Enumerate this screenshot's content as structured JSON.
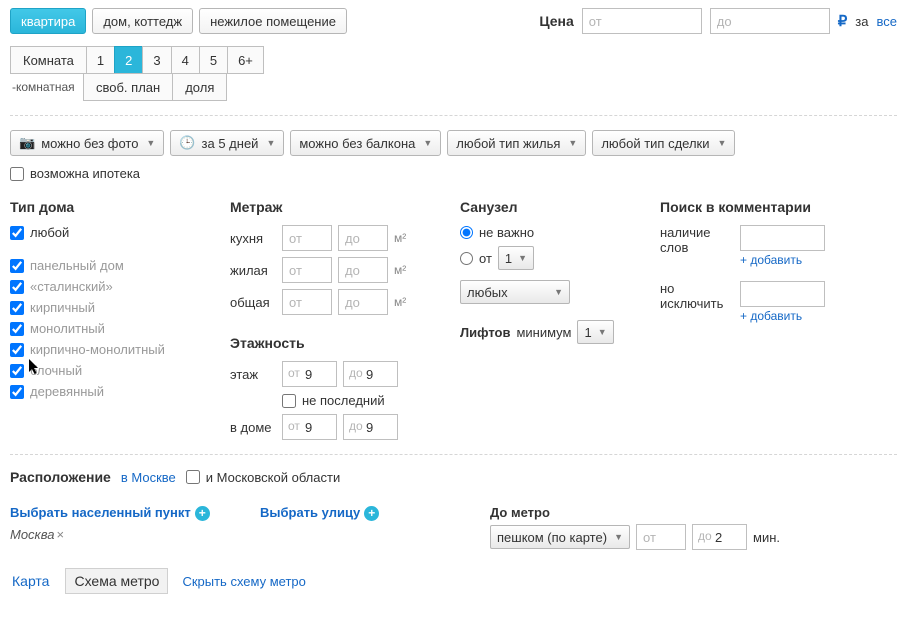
{
  "tabs": {
    "apartment": "квартира",
    "house": "дом, коттедж",
    "nonres": "нежилое помещение"
  },
  "price": {
    "label": "Цена",
    "from_ph": "от",
    "to_ph": "до",
    "for": "за",
    "all": "все"
  },
  "rooms": {
    "label": "Комната",
    "r1": "1",
    "r2": "2",
    "r3": "3",
    "r4": "4",
    "r5": "5",
    "r6": "6+",
    "suffix": "-комнатная",
    "free": "своб. план",
    "share": "доля"
  },
  "filters": {
    "photo": "можно без фото",
    "days": "за 5 дней",
    "balcony": "можно без балкона",
    "housing": "любой тип жилья",
    "deal": "любой тип сделки"
  },
  "mortgage": "возможна ипотека",
  "houseType": {
    "title": "Тип дома",
    "any": "любой",
    "panel": "панельный дом",
    "stalin": "«сталинский»",
    "brick": "кирпичный",
    "mono": "монолитный",
    "brickmono": "кирпично-монолитный",
    "block": "блочный",
    "wood": "деревянный"
  },
  "area": {
    "title": "Метраж",
    "kitchen": "кухня",
    "living": "жилая",
    "total": "общая",
    "from": "от",
    "to": "до",
    "unit": "м²"
  },
  "floors": {
    "title": "Этажность",
    "floor": "этаж",
    "from": "от",
    "to": "до",
    "val": "9",
    "notlast": "не последний",
    "inhouse": "в доме"
  },
  "bath": {
    "title": "Санузел",
    "nomatter": "не важно",
    "from": "от",
    "one": "1",
    "any": "любых"
  },
  "lifts": {
    "title": "Лифтов",
    "min": "минимум",
    "one": "1"
  },
  "comments": {
    "title": "Поиск в комментарии",
    "has": "наличие слов",
    "exclude": "но исключить",
    "add": "+ добавить"
  },
  "location": {
    "title": "Расположение",
    "inMoscow": "в Москве",
    "andRegion": "и Московской области",
    "chooseCity": "Выбрать населенный пункт",
    "city": "Москва",
    "chooseStreet": "Выбрать улицу",
    "toMetro": "До метро",
    "walk": "пешком (по карте)",
    "from": "от",
    "to": "до",
    "toval": "2",
    "min": "мин."
  },
  "maptabs": {
    "map": "Карта",
    "scheme": "Схема метро",
    "hide": "Скрыть схему метро"
  }
}
